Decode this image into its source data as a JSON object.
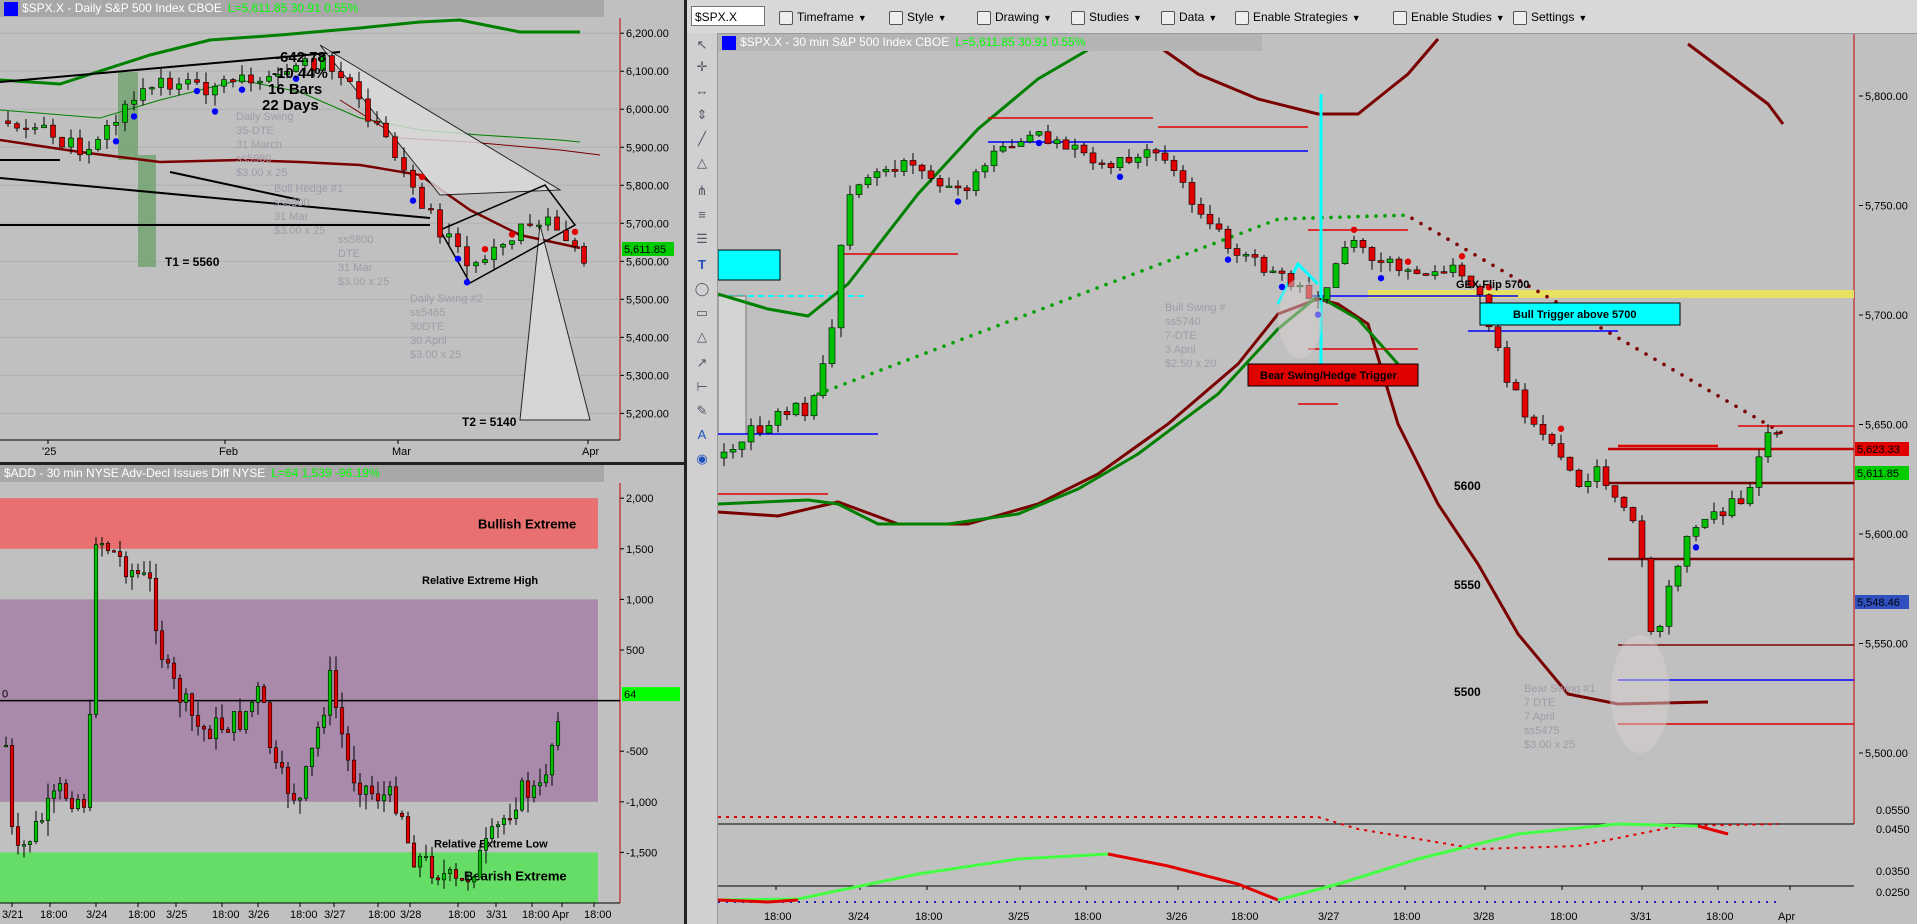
{
  "daily_panel": {
    "header": {
      "symbol": "$SPX.X",
      "desc": "Daily  S&P 500 Index  CBOE",
      "last": "L=5,611.85  30.91  0.55%"
    },
    "price_tag": "5,611.85",
    "annotations": {
      "count_line1": "-642.78",
      "count_line2": "-10.44%",
      "count_line3": "16 Bars",
      "count_line4": "22 Days",
      "t1": "T1 = 5560",
      "t2": "T2 = 5140",
      "ghost1": [
        "Daily Swing",
        "35-DTE",
        "31 March",
        "ss5980",
        "$3.00 x 25"
      ],
      "ghost2": [
        "Bull Hedge #1",
        "ss5800",
        "31 Mar",
        "$3.00 x 25"
      ],
      "ghost3": [
        "ss5800",
        "DTE",
        "31 Mar",
        "$3.00 x 25"
      ],
      "ghost4": [
        "Daily Swing #2",
        "ss5465",
        "30DTE",
        "30 April",
        "$3.00 x 25"
      ]
    }
  },
  "add_panel": {
    "header": {
      "symbol": "$ADD",
      "desc": "30 min  NYSE Adv-Decl Issues Diff  NYSE",
      "last": "L=64  1,539  -96.19%"
    },
    "zone_bullish": "Bullish Extreme",
    "zone_bearish": "Bearish Extreme",
    "rel_high": "Relative Extreme High",
    "rel_low": "Relative Extreme Low",
    "zero_label": "0",
    "price_tag": "64"
  },
  "intraday_panel": {
    "header": {
      "symbol": "$SPX.X",
      "desc": "30 min  S&P 500 Index  CBOE",
      "last": "L=5,611.85  30.91  0.55%"
    },
    "tags": {
      "p1": "5,623.33",
      "p2": "5,611.85",
      "p3": "5,548.46"
    },
    "levels": {
      "l5600": "5600",
      "l5550": "5550",
      "l5500": "5500"
    },
    "gex": "GEX Flip 5700",
    "bull_trigger": "Bull Trigger above 5700",
    "bear_trigger": "Bear Swing/Hedge Trigger",
    "ghost_bull": [
      "Bull Swing #",
      "ss5740",
      "7-DTE",
      "3 April",
      "$2.50 x 20"
    ],
    "ghost_bear": [
      "Bear Swing #1",
      "7 DTE",
      "7 April",
      "ss5475",
      "$3.00 x 25"
    ]
  },
  "toolbar": {
    "symbol": "$SPX.X",
    "items": [
      "Timeframe",
      "Style",
      "Drawing",
      "Studies",
      "Data",
      "Enable Strategies",
      "Enable Studies",
      "Settings"
    ]
  },
  "colors": {
    "background": "#c0c0c0",
    "up": "#00c000",
    "down": "#e00000",
    "band_green": "#008000",
    "band_red": "#7a0000",
    "bull_zone": "#e87070",
    "bear_zone": "#66dd66",
    "mid_zone": "#a98aab",
    "cyan": "#00ffff"
  },
  "chart_data": [
    {
      "type": "candlestick",
      "title": "$SPX.X - Daily  S&P 500 Index  CBOE",
      "y_ticks": [
        6200,
        6100,
        6000,
        5900,
        5800,
        5700,
        5600,
        5500,
        5400,
        5300,
        5200
      ],
      "x_ticks": [
        "'25",
        "Feb",
        "Mar",
        "Apr"
      ],
      "ylim": [
        5130,
        6240
      ]
    },
    {
      "type": "candlestick",
      "title": "$ADD - 30 min  NYSE Adv-Decl Issues Diff  NYSE",
      "y_ticks": [
        2000,
        1500,
        1000,
        500,
        -500,
        -1000,
        -1500
      ],
      "x_ticks": [
        "3/21",
        "18:00",
        "3/24",
        "18:00",
        "3/25",
        "18:00",
        "3/26",
        "18:00",
        "3/27",
        "18:00",
        "3/28",
        "18:00",
        "3/31",
        "18:00",
        "Apr",
        "18:00"
      ],
      "ylim": [
        -2000,
        2150
      ]
    },
    {
      "type": "candlestick",
      "title": "$SPX.X - 30 min  S&P 500 Index  CBOE",
      "y_ticks": [
        5800,
        5750,
        5700,
        5650,
        5600,
        5550,
        5500
      ],
      "x_ticks": [
        "18:00",
        "3/24",
        "18:00",
        "3/25",
        "18:00",
        "3/26",
        "18:00",
        "3/27",
        "18:00",
        "3/28",
        "18:00",
        "3/31",
        "18:00",
        "Apr"
      ],
      "ylim": [
        5470,
        5840
      ],
      "oscillator_ticks": [
        "0.0550",
        "0.0450",
        "0.0350",
        "0.0250"
      ]
    }
  ]
}
